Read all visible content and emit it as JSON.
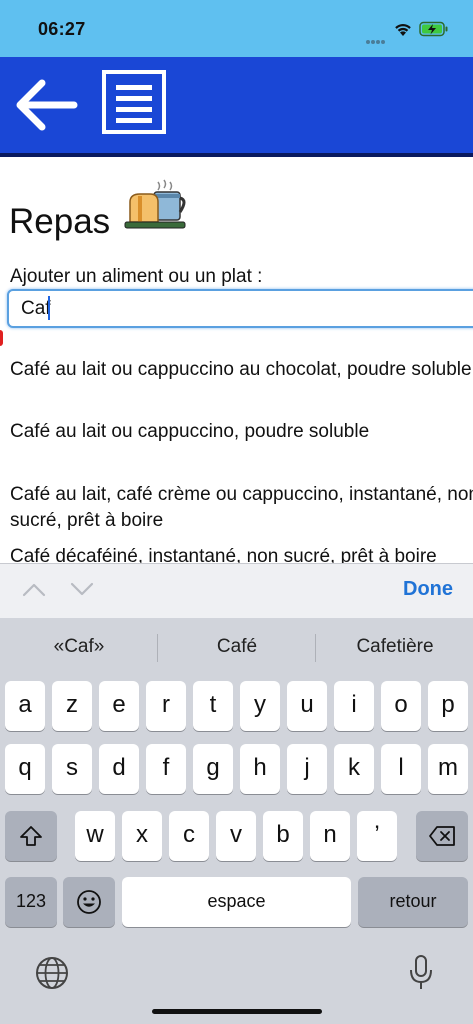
{
  "status_bar": {
    "time": "06:27"
  },
  "header": {
    "back_icon": "arrow-left",
    "menu_icon": "list-document"
  },
  "page": {
    "title": "Repas",
    "title_icon": "breakfast-tray",
    "field_label": "Ajouter un aliment ou un plat :",
    "search_value": "Caf"
  },
  "results": [
    "Café au lait ou cappuccino au chocolat, poudre soluble",
    "Café au lait ou cappuccino, poudre soluble",
    "Café au lait, café crème ou cappuccino, instantané, non sucré, prêt à boire",
    "Café décaféiné, instantané, non sucré, prêt à boire"
  ],
  "keyboard_toolbar": {
    "done_label": "Done"
  },
  "keyboard": {
    "suggestions": [
      "«Caf»",
      "Café",
      "Cafetière"
    ],
    "row1": [
      "a",
      "z",
      "e",
      "r",
      "t",
      "y",
      "u",
      "i",
      "o",
      "p"
    ],
    "row2": [
      "q",
      "s",
      "d",
      "f",
      "g",
      "h",
      "j",
      "k",
      "l",
      "m"
    ],
    "row3": [
      "w",
      "x",
      "c",
      "v",
      "b",
      "n",
      "’"
    ],
    "numbers_label": "123",
    "space_label": "espace",
    "return_label": "retour"
  },
  "colors": {
    "status_bar": "#5fc0f0",
    "header": "#1a47d6",
    "accent": "#2073d6"
  }
}
